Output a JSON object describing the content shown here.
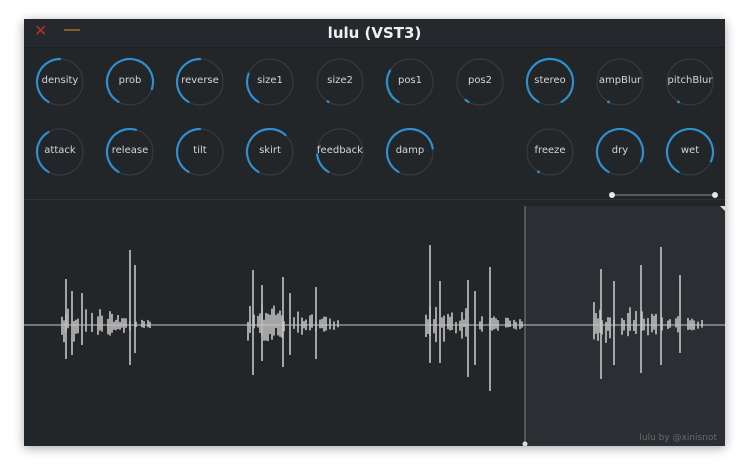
{
  "window": {
    "title": "lulu (VST3)"
  },
  "buttons": {
    "close_glyph": "✕",
    "minimize_glyph": "—",
    "close_color": "#b0302a",
    "minimize_color": "#c8901c"
  },
  "colors": {
    "arc": "#2f8fd0",
    "track": "#3a3e42",
    "wave": "#c4c4c4",
    "selection": "#2b2f33"
  },
  "knobs": [
    {
      "label": "density",
      "value": 0.5
    },
    {
      "label": "prob",
      "value": 0.86
    },
    {
      "label": "reverse",
      "value": 0.5
    },
    {
      "label": "size1",
      "value": 0.27
    },
    {
      "label": "size2",
      "value": 0.01
    },
    {
      "label": "pos1",
      "value": 0.3
    },
    {
      "label": "pos2",
      "value": 0.03
    },
    {
      "label": "stereo",
      "value": 1.0
    },
    {
      "label": "ampBlur",
      "value": 0.0
    },
    {
      "label": "pitchBlur",
      "value": 0.0
    },
    {
      "label": "attack",
      "value": 0.4
    },
    {
      "label": "release",
      "value": 0.55
    },
    {
      "label": "tilt",
      "value": 0.5
    },
    {
      "label": "skirt",
      "value": 0.64
    },
    {
      "label": "feedback",
      "value": 0.18
    },
    {
      "label": "damp",
      "value": 0.77
    },
    {
      "label": "freeze",
      "value": 0.0
    },
    {
      "label": "dry",
      "value": 0.88
    },
    {
      "label": "wet",
      "value": 0.88
    }
  ],
  "selection": {
    "start": 0.714,
    "end": 1.0
  },
  "range_slider": {
    "low": 0.0,
    "high": 1.0
  },
  "credit": "lulu by @xinisnot"
}
